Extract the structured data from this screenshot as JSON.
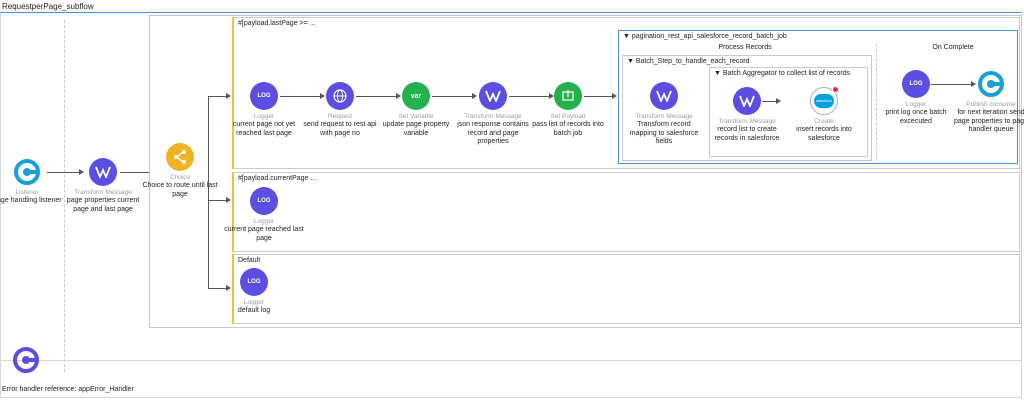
{
  "flow": {
    "name": "RequestperPage_subflow"
  },
  "source": {
    "type": "Listener",
    "label": "Page handling listener"
  },
  "transform1": {
    "type": "Transform Message",
    "label": "page properties current page and last page"
  },
  "choice": {
    "type": "Choice",
    "label": "Choice to route until last page"
  },
  "route1": {
    "condition": "#[payload.lastPage >= ...",
    "logger": {
      "type": "Logger",
      "label": "current page not yet reached last page"
    },
    "request": {
      "type": "Request",
      "label": "send request to rest api with page no"
    },
    "setvar": {
      "type": "Set Variable",
      "label": "update page property variable",
      "icon_text": "var"
    },
    "transform": {
      "type": "Transform Message",
      "label": "json response contains record and page properties"
    },
    "setpayload": {
      "type": "Set Payload",
      "label": "pass list of records into batch job"
    }
  },
  "batch": {
    "name": "pagination_rest_api_salesforce_record_batch_job",
    "process_records": "Process Records",
    "on_complete": "On Complete",
    "step": {
      "name": "Batch_Step_to_handle_each_record",
      "transform": {
        "type": "Transform Message",
        "label": "Transform record mapping to salesforce fields"
      },
      "aggregator": {
        "name": "Batch Aggregator to collect list of records",
        "transform": {
          "type": "Transform Message",
          "label": "record list to create records in salesforce"
        },
        "create": {
          "type": "Create",
          "label": "insert records into salesforce",
          "icon_text": "salesforce"
        }
      }
    },
    "complete_logger": {
      "type": "Logger",
      "label": "print log once batch excecuted"
    },
    "publish": {
      "type": "Publish consume",
      "label": "for next iteration send page properties to page handler queue"
    }
  },
  "route2": {
    "condition": "#[payload.currentPage ...",
    "logger": {
      "type": "Logger",
      "label": "current page reached last page"
    }
  },
  "route3": {
    "condition": "Default",
    "logger": {
      "type": "Logger",
      "label": "default log"
    }
  },
  "error_handler": {
    "label": "Error handler reference: appError_Handler"
  },
  "icons": {
    "logger": "LOG",
    "colors": {
      "purple": "#5a4fe2",
      "green": "#22b14c",
      "yellow": "#f0b323",
      "source": "#1aa0d8"
    }
  }
}
